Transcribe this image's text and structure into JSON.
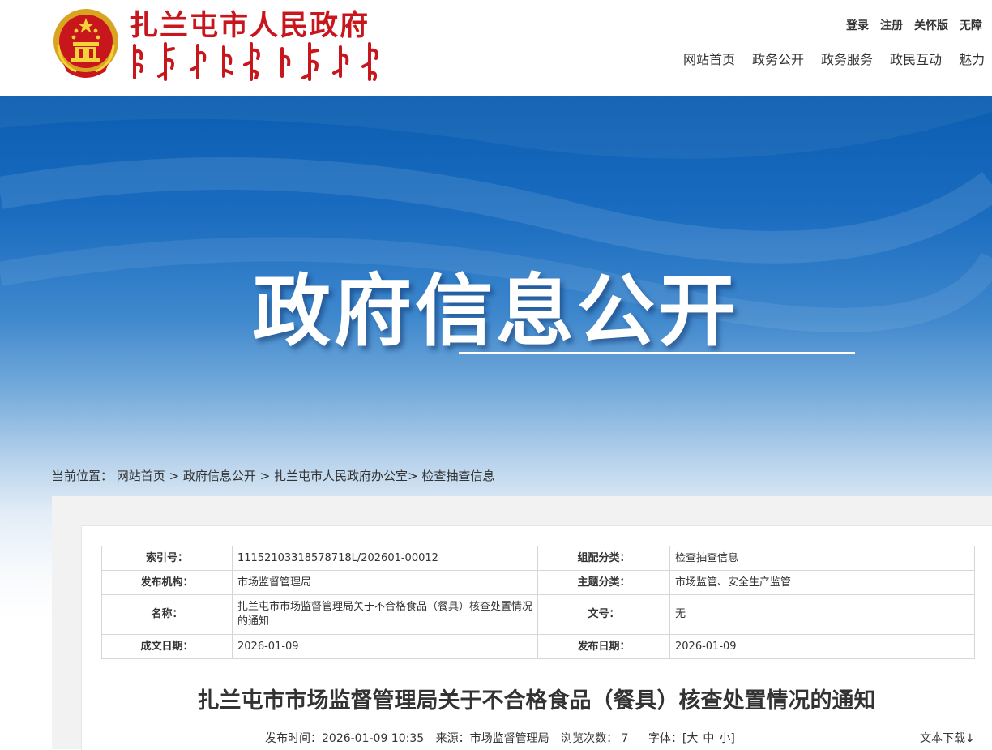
{
  "header": {
    "site_title": "扎兰屯市人民政府",
    "mongolian_title": "ᠵᠠᠯᠠᠨᠲᠤᠨ ᠬᠣᠲᠠ ᠶᠢᠨ ᠠᠷᠠᠳ ᠤᠨ ᠵᠠᠰᠠᠭ ᠤᠨ ᠭᠠᠵᠠᠷ",
    "util_links": [
      "登录",
      "注册",
      "关怀版",
      "无障"
    ],
    "nav": [
      "网站首页",
      "政务公开",
      "政务服务",
      "政民互动",
      "魅力"
    ]
  },
  "banner": {
    "title": "政府信息公开"
  },
  "breadcrumb": {
    "prefix": "当前位置：",
    "items": [
      "网站首页",
      "政府信息公开",
      "扎兰屯市人民政府办公室",
      "检查抽查信息"
    ],
    "separators": [
      " > ",
      " > ",
      "> "
    ]
  },
  "meta_table": {
    "rows": [
      {
        "k1": "索引号：",
        "v1": "11152103318578718L/202601-00012",
        "k2": "组配分类：",
        "v2": "检查抽查信息"
      },
      {
        "k1": "发布机构：",
        "v1": "市场监督管理局",
        "k2": "主题分类：",
        "v2": "市场监管、安全生产监管"
      },
      {
        "k1": "名称：",
        "v1": "扎兰屯市市场监督管理局关于不合格食品（餐具）核查处置情况的通知",
        "k2": "文号：",
        "v2": "无"
      },
      {
        "k1": "成文日期：",
        "v1": "2026-01-09",
        "k2": "发布日期：",
        "v2": "2026-01-09"
      }
    ]
  },
  "article": {
    "title": "扎兰屯市市场监督管理局关于不合格食品（餐具）核查处置情况的通知",
    "publish_time": "发布时间：2026-01-09 10:35",
    "source": "来源：市场监督管理局",
    "views": "浏览次数： 7",
    "font_label": "字体：",
    "font_open": "[",
    "font_sizes": [
      "大",
      "中",
      "小"
    ],
    "font_close": "]",
    "download": "文本下载↓"
  },
  "colors": {
    "brand_red": "#c8161d",
    "banner_blue": "#0a5db0"
  }
}
